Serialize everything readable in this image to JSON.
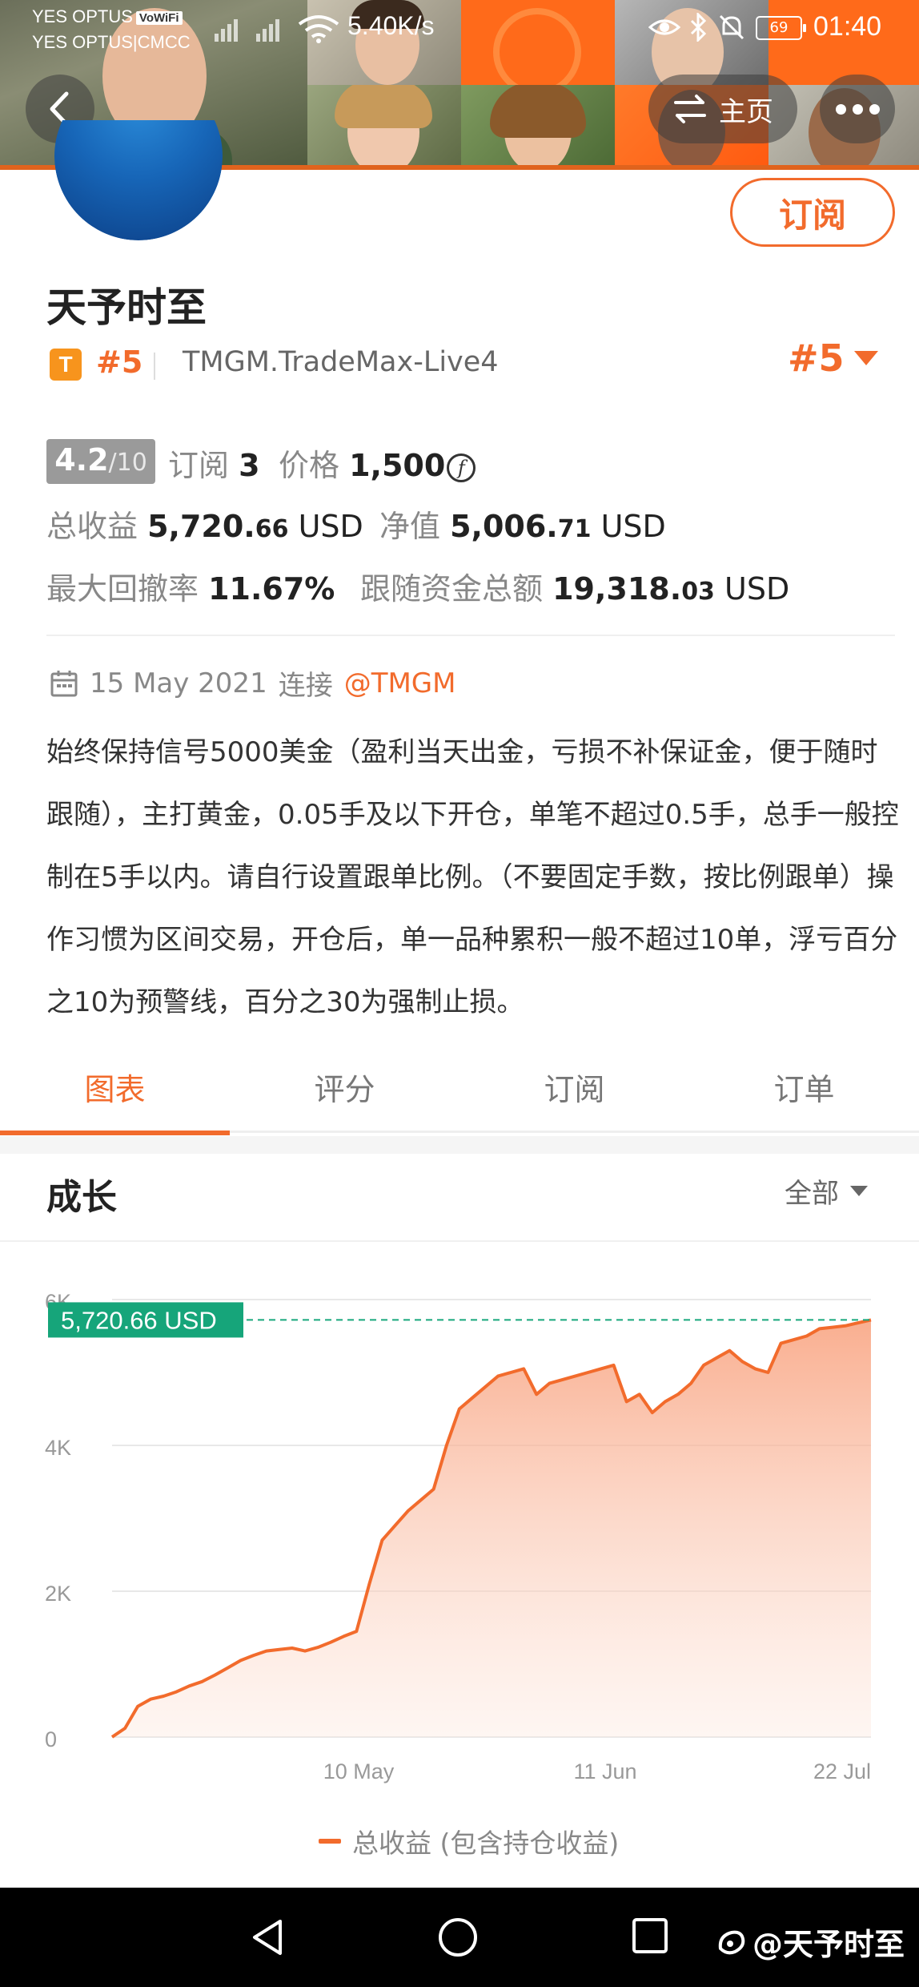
{
  "status_bar": {
    "carrier1": "YES OPTUS",
    "carrier1_badge": "VoWiFi",
    "carrier2": "YES OPTUS|CMCC",
    "net_speed": "5.40K/s",
    "battery": "69",
    "time": "01:40"
  },
  "header": {
    "home_label": "主页"
  },
  "profile": {
    "subscribe_label": "订阅",
    "name": "天予时至",
    "tier_badge": "T",
    "rank": "#5",
    "account": "TMGM.TradeMax-Live4",
    "rank_dropdown": "#5"
  },
  "stats": {
    "rating": "4.2",
    "rating_scale": "/10",
    "subscriptions_label": "订阅",
    "subscriptions": "3",
    "price_label": "价格",
    "price": "1,500",
    "total_profit_label": "总收益",
    "total_profit_int": "5,720.",
    "total_profit_dec": "66",
    "total_profit_unit": "USD",
    "equity_label": "净值",
    "equity_int": "5,006.",
    "equity_dec": "71",
    "equity_unit": "USD",
    "max_drawdown_label": "最大回撤率",
    "max_drawdown": "11.67%",
    "follow_funds_label": "跟随资金总额",
    "follow_funds_int": "19,318.",
    "follow_funds_dec": "03",
    "follow_funds_unit": "USD"
  },
  "connection": {
    "date": "15 May 2021",
    "connect_label": "连接",
    "broker": "@TMGM"
  },
  "description": "始终保持信号5000美金（盈利当天出金，亏损不补保证金，便于随时跟随），主打黄金，0.05手及以下开仓，单笔不超过0.5手，总手一般控制在5手以内。请自行设置跟单比例。（不要固定手数，按比例跟单）操作习惯为区间交易，开仓后，单一品种累积一般不超过10单，浮亏百分之10为预警线，百分之30为强制止损。",
  "tabs": [
    {
      "label": "图表",
      "active": true
    },
    {
      "label": "评分",
      "active": false
    },
    {
      "label": "订阅",
      "active": false
    },
    {
      "label": "订单",
      "active": false
    }
  ],
  "growth": {
    "title": "成长",
    "range_label": "全部"
  },
  "chart_data": {
    "type": "area",
    "title": "",
    "xlabel": "",
    "ylabel": "",
    "ylim": [
      0,
      6000
    ],
    "yticks": [
      0,
      2000,
      4000,
      6000
    ],
    "ytick_labels": [
      "0",
      "2K",
      "4K",
      "6K"
    ],
    "xticks": [
      "10 May",
      "11 Jun",
      "22 Jul"
    ],
    "current_value_label": "5,720.66 USD",
    "current_value": 5720.66,
    "legend": "总收益 (包含持仓收益)",
    "color": "#f26b2c",
    "grid": true,
    "series": [
      {
        "name": "总收益 (包含持仓收益)",
        "values": [
          0,
          120,
          420,
          520,
          560,
          620,
          700,
          760,
          850,
          950,
          1050,
          1120,
          1180,
          1200,
          1220,
          1180,
          1230,
          1300,
          1380,
          1450,
          2100,
          2700,
          2900,
          3100,
          3250,
          3400,
          4000,
          4500,
          4650,
          4800,
          4950,
          5000,
          5050,
          4700,
          4850,
          4900,
          4950,
          5000,
          5050,
          5100,
          4600,
          4700,
          4450,
          4600,
          4700,
          4850,
          5100,
          5200,
          5300,
          5150,
          5050,
          5000,
          5400,
          5450,
          5500,
          5600,
          5620,
          5640,
          5680,
          5720.66
        ]
      }
    ]
  },
  "nav_watermark": "@天予时至"
}
